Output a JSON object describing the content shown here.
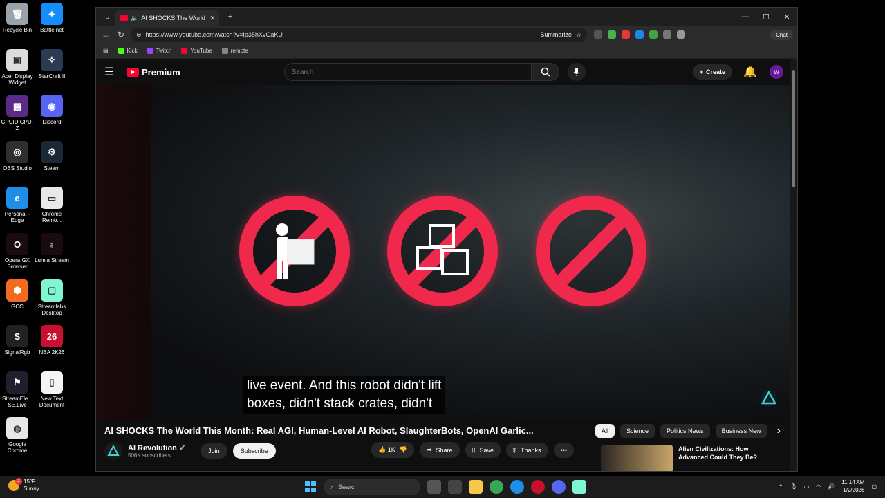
{
  "desktop": {
    "icons": [
      {
        "label": "Recycle Bin",
        "color": "#9aa3ab",
        "glyph": "🗑"
      },
      {
        "label": "Battle.net",
        "color": "#148eff",
        "glyph": "✦"
      },
      {
        "label": "Acer Display Widget",
        "color": "#dddddd",
        "glyph": "▣"
      },
      {
        "label": "StarCraft II",
        "color": "#2b3a55",
        "glyph": "✧"
      },
      {
        "label": "CPUID CPU-Z",
        "color": "#5b2a86",
        "glyph": "▦"
      },
      {
        "label": "Discord",
        "color": "#5865f2",
        "glyph": "◉"
      },
      {
        "label": "OBS Studio",
        "color": "#302e31",
        "glyph": "◎"
      },
      {
        "label": "Steam",
        "color": "#1b2838",
        "glyph": "⚙"
      },
      {
        "label": "Personal - Edge",
        "color": "#1f8ee8",
        "glyph": "e"
      },
      {
        "label": "Chrome Remo...",
        "color": "#e8e8e8",
        "glyph": "▭"
      },
      {
        "label": "Opera GX Browser",
        "color": "#1a0b12",
        "glyph": "O"
      },
      {
        "label": "Lumia Stream",
        "color": "#1a0b12",
        "glyph": "♁"
      },
      {
        "label": "GCC",
        "color": "#f36b21",
        "glyph": "⬢"
      },
      {
        "label": "Streamlabs Desktop",
        "color": "#80f5d2",
        "glyph": "▢"
      },
      {
        "label": "SignalRgb",
        "color": "#222222",
        "glyph": "S"
      },
      {
        "label": "NBA 2K26",
        "color": "#c8102e",
        "glyph": "26"
      },
      {
        "label": "StreamEle... SE.Live",
        "color": "#1f1f2e",
        "glyph": "⚑"
      },
      {
        "label": "New Text Document",
        "color": "#f4f4f4",
        "glyph": "▯"
      },
      {
        "label": "Google Chrome",
        "color": "#e8e8e8",
        "glyph": "◍"
      }
    ]
  },
  "browser": {
    "tab_title": "AI SHOCKS The World This M",
    "url": "https://www.youtube.com/watch?v=Ip35hXvGaKU",
    "summarize": "Summarize",
    "chat": "Chat",
    "bookmarks": [
      {
        "label": "Kick",
        "color": "#53fc18"
      },
      {
        "label": "Twitch",
        "color": "#9146ff"
      },
      {
        "label": "YouTube",
        "color": "#ff0033"
      },
      {
        "label": "remote",
        "color": "#888888"
      }
    ]
  },
  "youtube": {
    "brand": "Premium",
    "search_placeholder": "Search",
    "create": "Create",
    "avatar_letter": "W",
    "caption_line1": "live event. And this robot didn't lift",
    "caption_line2": "boxes, didn't stack crates, didn't",
    "video_title": "AI SHOCKS The World This Month: Real AGI, Human-Level AI Robot, SlaughterBots, OpenAI Garlic...",
    "channel_name": "AI Revolution",
    "subscribers": "506K subscribers",
    "join": "Join",
    "subscribe": "Subscribe",
    "likes": "1K",
    "share": "Share",
    "save": "Save",
    "thanks": "Thanks",
    "chips": [
      "All",
      "Science",
      "Politics News",
      "Business New"
    ],
    "rec_title": "Alien Civilizations: How Advanced Could They Be?"
  },
  "taskbar": {
    "temp": "15°F",
    "weather": "Sunny",
    "search": "Search",
    "time": "11:14 AM",
    "date": "1/2/2026",
    "weather_badge": "2"
  }
}
